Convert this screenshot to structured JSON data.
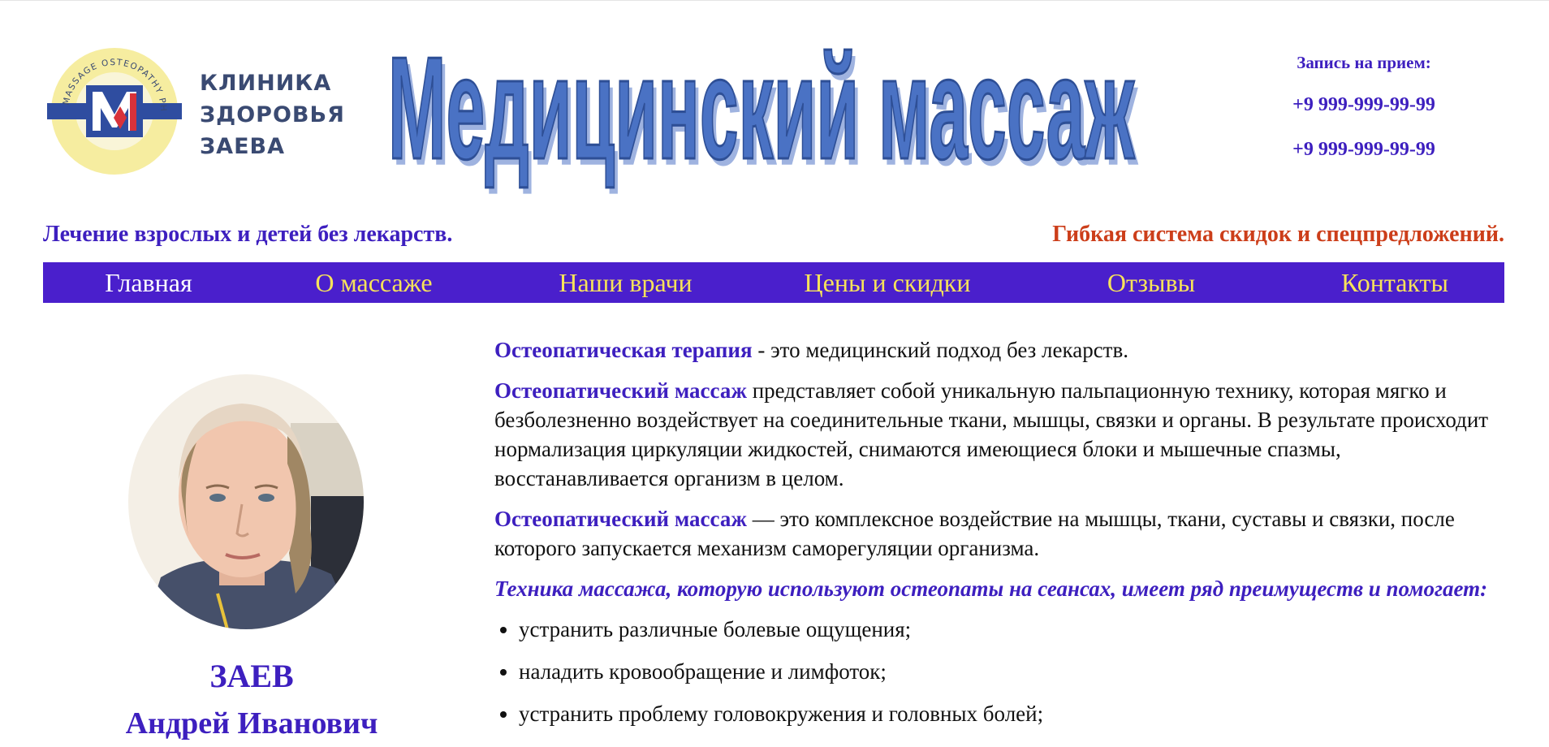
{
  "brand": {
    "seal_text": "MASSAGE OSTEOPATHY PHYSICAL THERAPY",
    "clinic_line1": "КЛИНИКА",
    "clinic_line2": "ЗДОРОВЬЯ",
    "clinic_line3": "ЗАЕВА",
    "headline": "Медицинский массаж"
  },
  "booking": {
    "label": "Запись на прием:",
    "phone1": "+9 999-999-99-99",
    "phone2": "+9 999-999-99-99"
  },
  "taglines": {
    "left": "Лечение взрослых и детей без лекарств.",
    "right": "Гибкая система скидок и спецпредложений."
  },
  "nav": [
    {
      "label": "Главная",
      "active": true
    },
    {
      "label": "О массаже",
      "active": false
    },
    {
      "label": "Наши врачи",
      "active": false
    },
    {
      "label": "Цены и скидки",
      "active": false
    },
    {
      "label": "Отзывы",
      "active": false
    },
    {
      "label": "Контакты",
      "active": false
    }
  ],
  "doctor": {
    "last_name": "ЗАЕВ",
    "first_names": "Андрей Иванович"
  },
  "content": {
    "p1_term": "Остеопатическая терапия",
    "p1_text": " - это медицинский подход без лекарств.",
    "p2_term": "Остеопатический массаж",
    "p2_text": " представляет собой уникальную пальпационную технику, которая мягко и безболезненно воздействует на соединительные ткани, мышцы, связки и органы. В результате происходит нормализация циркуляции жидкостей, снимаются имеющиеся блоки и мышечные спазмы, восстанавливается организм в целом.",
    "p3_term": "Остеопатический массаж",
    "p3_text": " — это комплексное воздействие на мышцы, ткани, суставы и связки, после которого запускается механизм саморегуляции организма.",
    "lead": "Техника массажа, которую используют остеопаты на сеансах, имеет ряд преимуществ и помогает:",
    "bullets": [
      "устранить различные болевые ощущения;",
      "наладить кровообращение и лимфоток;",
      "устранить проблему головокружения и головных болей;"
    ]
  },
  "colors": {
    "brand_purple": "#4a1fcc",
    "text_purple": "#3d1fbf",
    "accent_red": "#cc3e1a",
    "nav_inactive": "#f7e35a",
    "headline_blue": "#4a72c4"
  }
}
